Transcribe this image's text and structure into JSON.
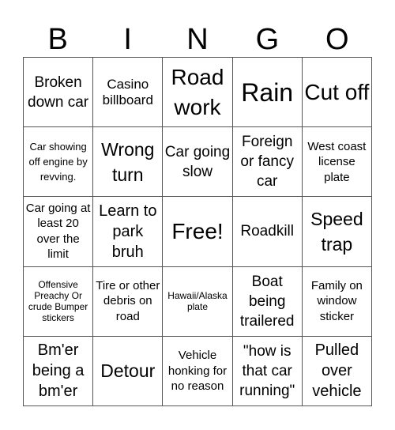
{
  "header": [
    "B",
    "I",
    "N",
    "G",
    "O"
  ],
  "cells": [
    "Broken down car",
    "Casino billboard",
    "Road work",
    "Rain",
    "Cut off",
    "Car showing off engine by revving.",
    "Wrong turn",
    "Car going slow",
    "Foreign or fancy car",
    "West coast license plate",
    "Car going at least 20 over the limit",
    "Learn to park bruh",
    "Free!",
    "Roadkill",
    "Speed trap",
    "Offensive Preachy Or crude Bumper stickers",
    "Tire or other debris on road",
    "Hawaii/Alaska plate",
    "Boat being trailered",
    "Family on window sticker",
    "Bm'er being a bm'er",
    "Detour",
    "Vehicle honking for no reason",
    "\"how is that car running\"",
    "Pulled over vehicle"
  ]
}
